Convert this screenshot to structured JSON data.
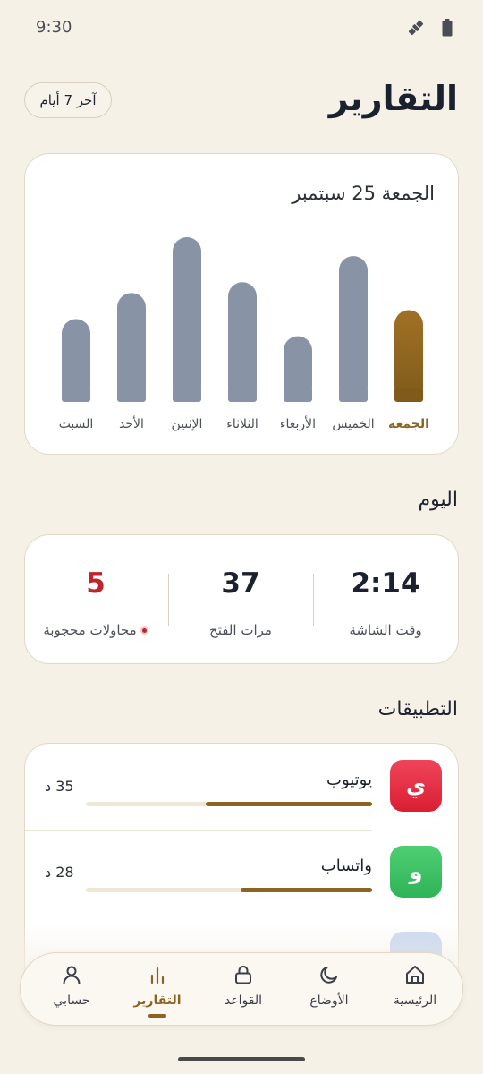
{
  "status": {
    "time": "9:30"
  },
  "header": {
    "title": "التقارير",
    "range_chip": "آخر 7 أيام"
  },
  "chart_data": {
    "type": "bar",
    "date_label": "الجمعة 25 سبتمبر",
    "categories": [
      "السبت",
      "الأحد",
      "الإثنين",
      "الثلاثاء",
      "الأربعاء",
      "الخميس",
      "الجمعة"
    ],
    "values": [
      92,
      121,
      183,
      133,
      73,
      162,
      102
    ],
    "ylim": [
      0,
      183
    ],
    "highlight_index": 6,
    "colors": {
      "bar": "#8893a5",
      "highlight_top": "#a07124",
      "highlight_bottom": "#7f5a1b",
      "highlight_label": "#8a6420",
      "label": "#4c505a"
    }
  },
  "today": {
    "title": "اليوم",
    "screen_time": {
      "value": "2:14",
      "label": "وقت الشاشة"
    },
    "opens": {
      "value": "37",
      "label": "مرات الفتح"
    },
    "blocked": {
      "value": "5",
      "label": "محاولات محجوبة",
      "color": "#c0242a"
    }
  },
  "apps": {
    "title": "التطبيقات",
    "items": [
      {
        "name": "يوتيوب",
        "letter": "ي",
        "time": "35 د",
        "fraction": 0.58,
        "color_top": "#f0445a",
        "color_bottom": "#d91f32"
      },
      {
        "name": "واتساب",
        "letter": "و",
        "time": "28 د",
        "fraction": 0.46,
        "color_top": "#4fce74",
        "color_bottom": "#2fb457"
      }
    ]
  },
  "nav": {
    "items": [
      {
        "label": "الرئيسية",
        "icon": "home-icon"
      },
      {
        "label": "الأوضاع",
        "icon": "moon-icon"
      },
      {
        "label": "القواعد",
        "icon": "lock-icon"
      },
      {
        "label": "التقارير",
        "icon": "bar-chart-icon"
      },
      {
        "label": "حسابي",
        "icon": "person-icon"
      }
    ],
    "active_index": 3,
    "accent": "#8a6420"
  }
}
